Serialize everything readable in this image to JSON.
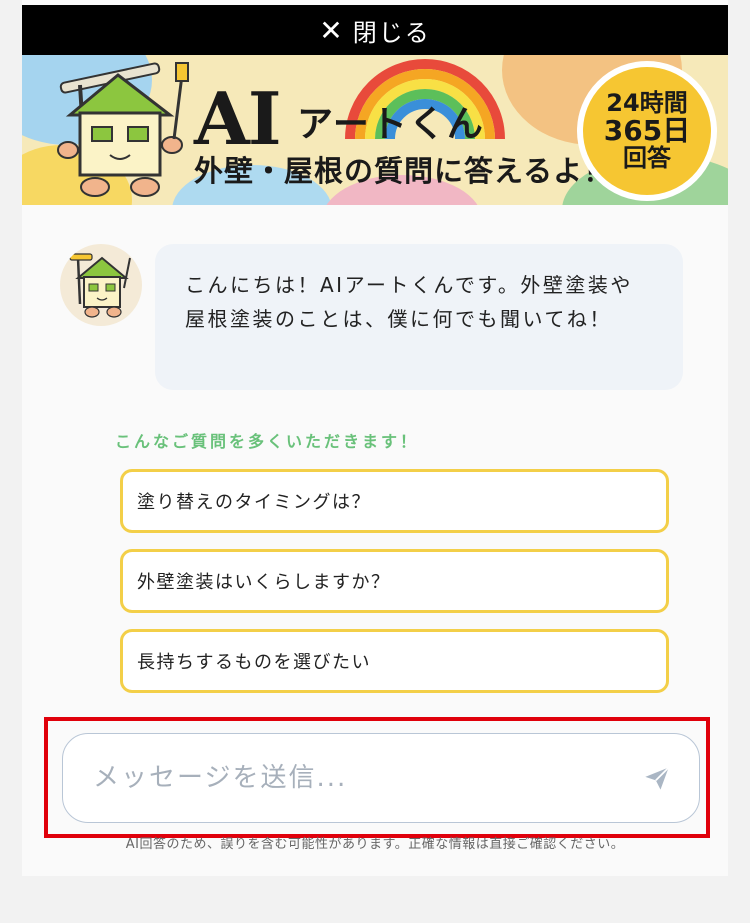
{
  "topbar": {
    "close_icon": "close-icon",
    "close_label": "閉じる"
  },
  "banner": {
    "title_ai": "AI",
    "title_art": "アートくん",
    "subtitle": "外壁・屋根の質問に答えるよ！",
    "badge_line1": "24時間",
    "badge_line2": "365日",
    "badge_line3": "回答",
    "mascot_icon": "house-mascot-icon",
    "rainbow_icon": "rainbow-icon"
  },
  "chat": {
    "avatar_icon": "house-mascot-icon",
    "greeting": "こんにちは！AIアートくんです。外壁塗装や屋根塗装のことは、僕に何でも聞いてね！"
  },
  "suggestions": {
    "heading": "こんなご質問を多くいただきます！",
    "items": [
      "塗り替えのタイミングは？",
      "外壁塗装はいくらしますか？",
      "長持ちするものを選びたい"
    ]
  },
  "input": {
    "placeholder": "メッセージを送信...",
    "value": "",
    "send_icon": "send-icon"
  },
  "disclaimer": "AI回答のため、誤りを含む可能性があります。正確な情報は直接ご確認ください。",
  "colors": {
    "accent_green": "#69c17a",
    "suggestion_border": "#f3cf48",
    "highlight_red": "#e0000b",
    "bubble_bg": "#eff3f8"
  }
}
